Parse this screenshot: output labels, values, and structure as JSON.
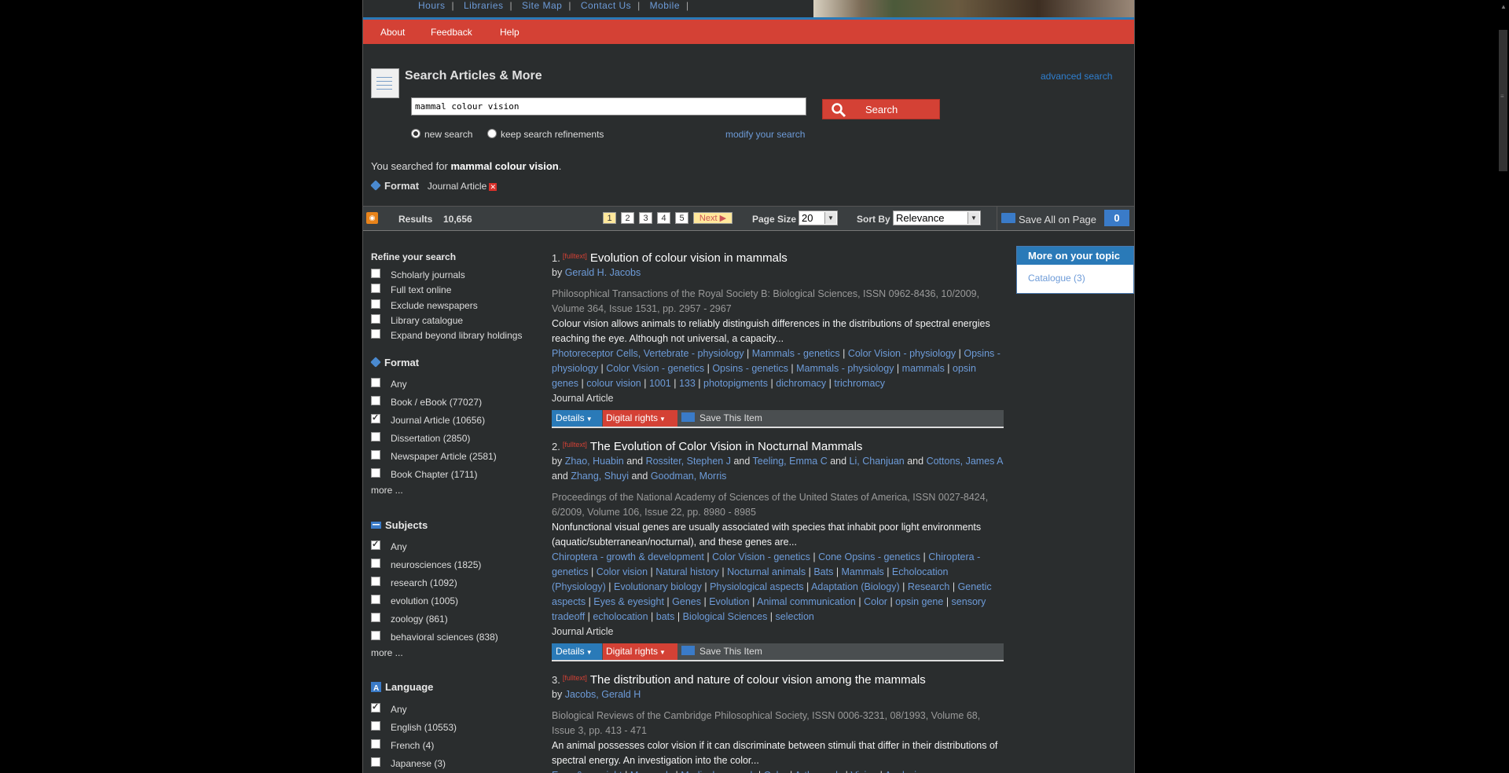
{
  "top_links": [
    "Hours",
    "Libraries",
    "Site Map",
    "Contact Us",
    "Mobile"
  ],
  "nav": [
    "About",
    "Feedback",
    "Help"
  ],
  "search": {
    "title": "Search Articles & More",
    "advanced": "advanced search",
    "query": "mammal colour vision",
    "button": "Search",
    "new_search": "new search",
    "keep": "keep search refinements",
    "modify": "modify your search"
  },
  "summary": {
    "prefix": "You searched for ",
    "query": "mammal colour vision",
    "suffix": ".",
    "filter_label": "Format",
    "filter_value": "Journal Article"
  },
  "toolbar": {
    "results_label": "Results",
    "results_count": "10,656",
    "pages": [
      "1",
      "2",
      "3",
      "4",
      "5"
    ],
    "next": "Next",
    "page_size_label": "Page Size",
    "page_size": "20",
    "sort_label": "Sort By",
    "sort_value": "Relevance",
    "save_all": "Save All on Page",
    "saved_count": "0"
  },
  "sidebar": {
    "refine_title": "Refine your search",
    "refine": [
      "Scholarly journals",
      "Full text online",
      "Exclude newspapers",
      "Library catalogue",
      "Expand beyond library holdings"
    ],
    "format_title": "Format",
    "format": [
      {
        "label": "Any",
        "checked": false
      },
      {
        "label": "Book / eBook (77027)",
        "checked": false
      },
      {
        "label": "Journal Article (10656)",
        "checked": true
      },
      {
        "label": "Dissertation (2850)",
        "checked": false
      },
      {
        "label": "Newspaper Article (2581)",
        "checked": false
      },
      {
        "label": "Book Chapter (1711)",
        "checked": false
      }
    ],
    "more": "more ...",
    "subjects_title": "Subjects",
    "subjects": [
      {
        "label": "Any",
        "checked": true
      },
      {
        "label": "neurosciences (1825)",
        "checked": false
      },
      {
        "label": "research (1092)",
        "checked": false
      },
      {
        "label": "evolution (1005)",
        "checked": false
      },
      {
        "label": "zoology (861)",
        "checked": false
      },
      {
        "label": "behavioral sciences (838)",
        "checked": false
      }
    ],
    "language_title": "Language",
    "language": [
      {
        "label": "Any",
        "checked": true
      },
      {
        "label": "English (10553)",
        "checked": false
      },
      {
        "label": "French (4)",
        "checked": false
      },
      {
        "label": "Japanese (3)",
        "checked": false
      }
    ]
  },
  "results": [
    {
      "num": "1.",
      "fulltext": "[fulltext]",
      "title": "Evolution of colour vision in mammals",
      "by": "by",
      "authors": [
        "Gerald H. Jacobs"
      ],
      "source": "Philosophical Transactions of the Royal Society B: Biological Sciences, ISSN 0962-8436, 10/2009, Volume 364, Issue 1531, pp. 2957 - 2967",
      "abstract": "Colour vision allows animals to reliably distinguish differences in the distributions of spectral energies reaching the eye. Although not universal, a capacity...",
      "subjects": [
        "Photoreceptor Cells, Vertebrate - physiology",
        "Mammals - genetics",
        "Color Vision - physiology",
        "Opsins - physiology",
        "Color Vision - genetics",
        "Opsins - genetics",
        "Mammals - physiology",
        "mammals",
        "opsin genes",
        "colour vision",
        "1001",
        "133",
        "photopigments",
        "dichromacy",
        "trichromacy"
      ],
      "type": "Journal Article"
    },
    {
      "num": "2.",
      "fulltext": "[fulltext]",
      "title": "The Evolution of Color Vision in Nocturnal Mammals",
      "by": "by",
      "authors": [
        "Zhao, Huabin",
        "Rossiter, Stephen J",
        "Teeling, Emma C",
        "Li, Chanjuan",
        "Cottons, James A",
        "Zhang, Shuyi",
        "Goodman, Morris"
      ],
      "source": "Proceedings of the National Academy of Sciences of the United States of America, ISSN 0027-8424, 6/2009, Volume 106, Issue 22, pp. 8980 - 8985",
      "abstract": "Nonfunctional visual genes are usually associated with species that inhabit poor light environments (aquatic/subterranean/nocturnal), and these genes are...",
      "subjects": [
        "Chiroptera - growth & development",
        "Color Vision - genetics",
        "Cone Opsins - genetics",
        "Chiroptera - genetics",
        "Color vision",
        "Natural history",
        "Nocturnal animals",
        "Bats",
        "Mammals",
        "Echolocation (Physiology)",
        "Evolutionary biology",
        "Physiological aspects",
        "Adaptation (Biology)",
        "Research",
        "Genetic aspects",
        "Eyes & eyesight",
        "Genes",
        "Evolution",
        "Animal communication",
        "Color",
        "opsin gene",
        "sensory tradeoff",
        "echolocation",
        "bats",
        "Biological Sciences",
        "selection"
      ],
      "type": "Journal Article"
    },
    {
      "num": "3.",
      "fulltext": "[fulltext]",
      "title": "The distribution and nature of colour vision among the mammals",
      "by": "by",
      "authors": [
        "Jacobs, Gerald H"
      ],
      "source": "Biological Reviews of the Cambridge Philosophical Society, ISSN 0006-3231, 08/1993, Volume 68, Issue 3, pp. 413 - 471",
      "abstract": "An animal possesses color vision if it can discriminate between stimuli that differ in their distributions of spectral energy. An investigation into the color...",
      "subjects": [
        "Eyes & eyesight",
        "Mammals",
        "Medical research",
        "Color",
        "Arthropods",
        "Vision",
        "Analysis"
      ],
      "type": ""
    }
  ],
  "actions": {
    "details": "Details",
    "digital": "Digital rights",
    "save": "Save This Item"
  },
  "more_panel": {
    "title": "More on your topic",
    "item": "Catalogue (3)"
  }
}
